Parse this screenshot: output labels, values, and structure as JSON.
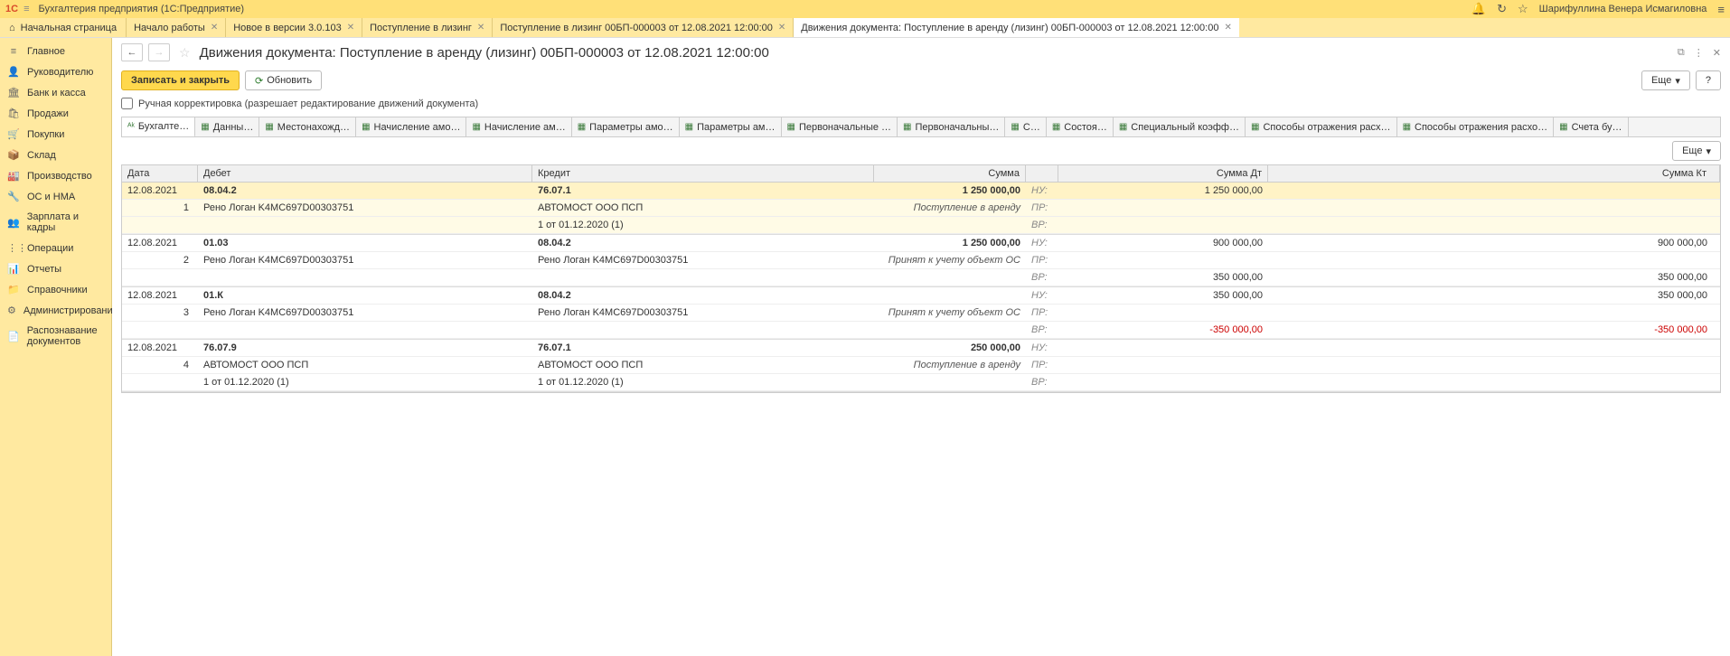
{
  "app": {
    "title": "Бухгалтерия предприятия  (1С:Предприятие)",
    "user": "Шарифуллина Венера Исмагиловна"
  },
  "home_tab": "Начальная страница",
  "tabs": [
    {
      "label": "Начало работы"
    },
    {
      "label": "Новое в версии 3.0.103"
    },
    {
      "label": "Поступление в лизинг"
    },
    {
      "label": "Поступление в лизинг 00БП-000003 от 12.08.2021 12:00:00"
    },
    {
      "label": "Движения документа: Поступление в аренду (лизинг) 00БП-000003 от 12.08.2021 12:00:00",
      "active": true
    }
  ],
  "sidebar": [
    {
      "icon": "≡",
      "label": "Главное"
    },
    {
      "icon": "👤",
      "label": "Руководителю"
    },
    {
      "icon": "🏛",
      "label": "Банк и касса"
    },
    {
      "icon": "🛍",
      "label": "Продажи"
    },
    {
      "icon": "🛒",
      "label": "Покупки"
    },
    {
      "icon": "📦",
      "label": "Склад"
    },
    {
      "icon": "🏭",
      "label": "Производство"
    },
    {
      "icon": "🔧",
      "label": "ОС и НМА"
    },
    {
      "icon": "👥",
      "label": "Зарплата и кадры"
    },
    {
      "icon": "⋮⋮",
      "label": "Операции"
    },
    {
      "icon": "📊",
      "label": "Отчеты"
    },
    {
      "icon": "📁",
      "label": "Справочники"
    },
    {
      "icon": "⚙",
      "label": "Администрирование"
    },
    {
      "icon": "📄",
      "label": "Распознавание документов"
    }
  ],
  "doc": {
    "title": "Движения документа: Поступление в аренду (лизинг) 00БП-000003 от 12.08.2021 12:00:00",
    "save_close": "Записать и закрыть",
    "refresh": "Обновить",
    "more": "Еще",
    "help": "?",
    "manual": "Ручная корректировка (разрешает редактирование движений документа)"
  },
  "subtabs": [
    "Бухгалте…",
    "Данны…",
    "Местонахожд…",
    "Начисление амо…",
    "Начисление ам…",
    "Параметры амо…",
    "Параметры ам…",
    "Первоначальные …",
    "Первоначальны…",
    "С…",
    "Состоя…",
    "Специальный коэфф…",
    "Способы отражения расх…",
    "Способы отражения расхо…",
    "Счета бу…"
  ],
  "grid": {
    "headers": {
      "date": "Дата",
      "debit": "Дебет",
      "credit": "Кредит",
      "sum": "Сумма",
      "sumdt": "Сумма Дт",
      "sumkt": "Сумма Кт"
    },
    "labels": {
      "nu": "НУ:",
      "pr": "ПР:",
      "vr": "ВР:"
    },
    "entries": [
      {
        "sel": true,
        "date": "12.08.2021",
        "num": "1",
        "deb": "08.04.2",
        "deb2": "Рено Логан K4MC697D00303751",
        "deb3": "",
        "kre": "76.07.1",
        "kre2": "АВТОМОСТ ООО ПСП",
        "kre3": "1 от 01.12.2020 (1)",
        "sum": "1 250 000,00",
        "op": "Поступление в аренду",
        "dt_nu": "1 250 000,00",
        "kt_nu": "",
        "dt_pr": "",
        "kt_pr": "",
        "dt_vr": "",
        "kt_vr": ""
      },
      {
        "date": "12.08.2021",
        "num": "2",
        "deb": "01.03",
        "deb2": "Рено Логан K4MC697D00303751",
        "deb3": "",
        "kre": "08.04.2",
        "kre2": "Рено Логан K4MC697D00303751",
        "kre3": "",
        "sum": "1 250 000,00",
        "op": "Принят к учету объект ОС",
        "dt_nu": "900 000,00",
        "kt_nu": "900 000,00",
        "dt_pr": "",
        "kt_pr": "",
        "dt_vr": "350 000,00",
        "kt_vr": "350 000,00"
      },
      {
        "date": "12.08.2021",
        "num": "3",
        "deb": "01.К",
        "deb2": "Рено Логан K4MC697D00303751",
        "deb3": "",
        "kre": "08.04.2",
        "kre2": "Рено Логан K4MC697D00303751",
        "kre3": "",
        "sum": "",
        "op": "Принят к учету объект ОС",
        "dt_nu": "350 000,00",
        "kt_nu": "350 000,00",
        "dt_pr": "",
        "kt_pr": "",
        "dt_vr": "-350 000,00",
        "kt_vr": "-350 000,00",
        "neg": true
      },
      {
        "date": "12.08.2021",
        "num": "4",
        "deb": "76.07.9",
        "deb2": "АВТОМОСТ ООО ПСП",
        "deb3": "1 от 01.12.2020 (1)",
        "kre": "76.07.1",
        "kre2": "АВТОМОСТ ООО ПСП",
        "kre3": "1 от 01.12.2020 (1)",
        "sum": "250 000,00",
        "op": "Поступление в аренду",
        "dt_nu": "",
        "kt_nu": "",
        "dt_pr": "",
        "kt_pr": "",
        "dt_vr": "",
        "kt_vr": ""
      }
    ]
  }
}
